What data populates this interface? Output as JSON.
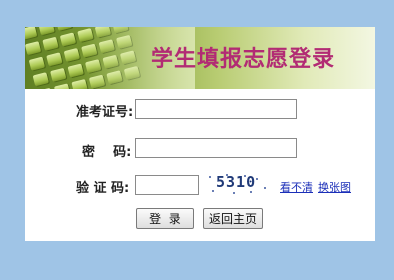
{
  "page": {
    "title": "学生填报志愿登录"
  },
  "form": {
    "exam_id_label": "准考证号:",
    "exam_id_value": "",
    "password_label": "密    码:",
    "password_value": "",
    "captcha_label": "验 证 码:",
    "captcha_value": "",
    "captcha_code": "5310",
    "cant_see_link": "看不清",
    "change_image_link": "换张图"
  },
  "buttons": {
    "login": "登  录",
    "back_home": "返回主页"
  },
  "colors": {
    "background": "#9fc4e6",
    "title": "#b22b74",
    "link": "#1b2fb8",
    "banner_green": "#86a43a"
  }
}
